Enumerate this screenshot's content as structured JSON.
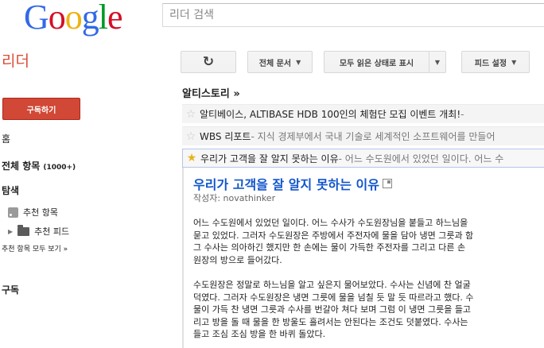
{
  "header": {
    "logo_letters": [
      "G",
      "o",
      "o",
      "g",
      "l",
      "e"
    ],
    "logo_colors": [
      "#3369e8",
      "#d50f25",
      "#eeb211",
      "#3369e8",
      "#009925",
      "#d50f25"
    ],
    "search_placeholder": "리더 검색"
  },
  "app": {
    "title": "리더"
  },
  "toolbar": {
    "refresh_icon": "refresh-icon",
    "all_docs": "전체 문서",
    "mark_all_read": "모두 읽은 상태로 표시",
    "feed_settings": "피드 설정"
  },
  "sidebar": {
    "subscribe": "구독하기",
    "home": "홈",
    "all_items": "전체 항목",
    "all_items_count": "(1000+)",
    "explore": "탐색",
    "recommended_items": "추천 항목",
    "recommended_feeds": "추천 피드",
    "recommended_all": "추천 항목 모두 보기 »",
    "subscriptions": "구독"
  },
  "stream": {
    "title": "알티스토리 »",
    "items": [
      {
        "title": "알티베이스, ALTIBASE HDB 100인의 체험단 모집 이벤트 개최!",
        "snippet": " - ",
        "starred": false
      },
      {
        "title": "WBS 리포트",
        "snippet": " - 지식 경제부에서 국내 기술로 세계적인 소프트웨어를 만들어",
        "starred": false
      },
      {
        "title": "우리가 고객을 잘 알지 못하는 이유",
        "snippet": " - 어느 수도원에서 있었던 일이다. 어느 수",
        "starred": true
      }
    ]
  },
  "entry": {
    "title": "우리가 고객을 잘 알지 못하는 이유",
    "author": "작성자: novathinker",
    "paragraph1": [
      "어느 수도원에서 있었던 일이다. 어느 수사가 수도원장님을 붙들고 하느님을",
      "묻고 있었다. 그러자 수도원장은 주방에서 주전자에 물을 담아 냉면 그릇과 함",
      "그 수사는 의아하긴 했지만 한 손에는 물이 가득한 주전자를 그리고 다른 손",
      "원장의 방으로 들어갔다."
    ],
    "paragraph2": [
      "수도원장은 정말로 하느님을 알고 싶은지 물어보았다. 수사는 신념에 찬 얼굴",
      "덕였다. 그러자 수도원장은 냉면 그릇에 물을 넘칠 듯 말 듯 따르라고 했다. 수",
      "물이 가득 찬 냉면 그릇과 수사를 번갈아 쳐다 보며 그럼 이 냉면 그릇을 들고",
      "리고 방을 돌 때 물을 한 방울도 흘려서는 안된다는 조건도 덧붙였다. 수사는",
      "들고 조심 조심 방을 한 바퀴 돌았다."
    ]
  }
}
